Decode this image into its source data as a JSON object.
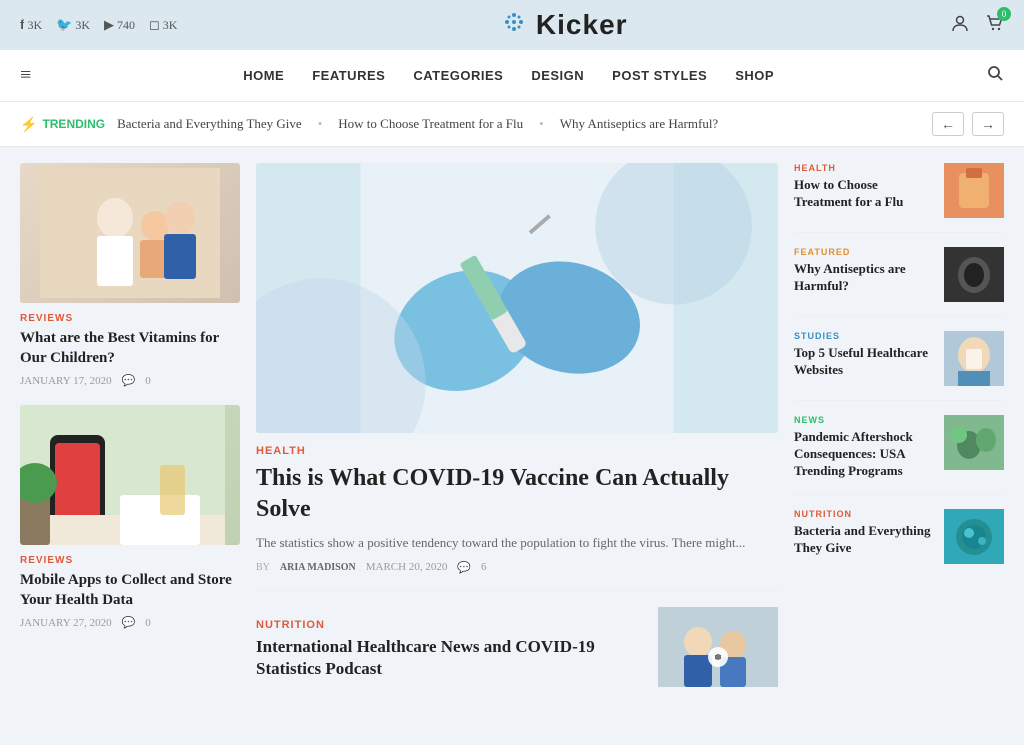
{
  "topBar": {
    "social": [
      {
        "icon": "f",
        "label": "3K",
        "name": "facebook"
      },
      {
        "icon": "🐦",
        "label": "3K",
        "name": "twitter"
      },
      {
        "icon": "▶",
        "label": "740",
        "name": "youtube"
      },
      {
        "icon": "📷",
        "label": "3K",
        "name": "instagram"
      }
    ]
  },
  "logo": {
    "icon": "⊕",
    "text": "Kicker"
  },
  "nav": {
    "hamburger": "≡",
    "links": [
      "HOME",
      "FEATURES",
      "CATEGORIES",
      "DESIGN",
      "POST STYLES",
      "SHOP"
    ],
    "searchIcon": "🔍"
  },
  "trending": {
    "label": "TRENDING",
    "items": [
      "Bacteria and Everything They Give",
      "How to Choose Treatment for a Flu",
      "Why Antiseptics are Harmful?"
    ]
  },
  "leftCol": {
    "articles": [
      {
        "category": "REVIEWS",
        "title": "What are the Best Vitamins for Our Children?",
        "date": "JANUARY 17, 2020",
        "comments": "0"
      },
      {
        "category": "REVIEWS",
        "title": "Mobile Apps to Collect and Store Your Health Data",
        "date": "JANUARY 27, 2020",
        "comments": "0"
      }
    ]
  },
  "centerCol": {
    "featured": {
      "category": "HEALTH",
      "title": "This is What COVID-19 Vaccine Can Actually Solve",
      "excerpt": "The statistics show a positive tendency toward the population to fight the virus. There might...",
      "author": "ARIA MADISON",
      "date": "MARCH 20, 2020",
      "comments": "6"
    },
    "bottom": {
      "category": "NUTRITION",
      "title": "International Healthcare News and COVID-19 Statistics Podcast"
    }
  },
  "rightCol": {
    "articles": [
      {
        "category": "HEALTH",
        "title": "How to Choose Treatment for a Flu"
      },
      {
        "category": "FEATURED",
        "title": "Why Antiseptics are Harmful?"
      },
      {
        "category": "STUDIES",
        "title": "Top 5 Useful Healthcare Websites"
      },
      {
        "category": "NEWS",
        "title": "Pandemic Aftershock Consequences: USA Trending Programs"
      },
      {
        "category": "NUTRITION",
        "title": "Bacteria and Everything They Give"
      }
    ]
  },
  "colors": {
    "accent": "#e05a3a",
    "green": "#2dbe6c",
    "blue": "#3a8fc4"
  }
}
